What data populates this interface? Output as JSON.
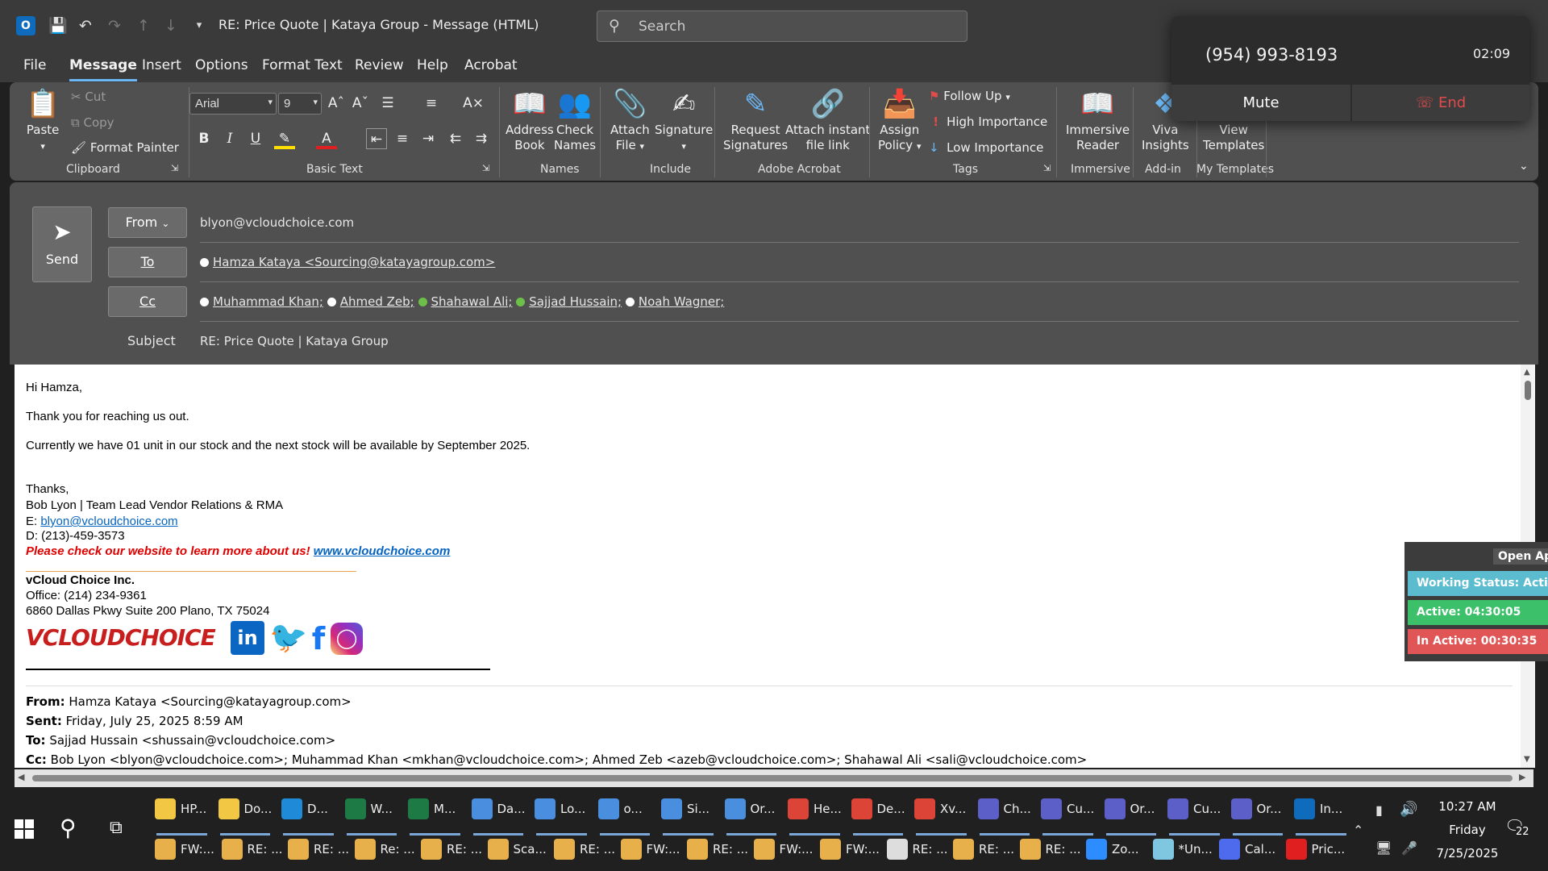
{
  "titlebar": {
    "title": "RE: Price Quote | Kataya Group  -  Message (HTML)",
    "search_placeholder": "Search"
  },
  "menu": [
    "File",
    "Message",
    "Insert",
    "Options",
    "Format Text",
    "Review",
    "Help",
    "Acrobat"
  ],
  "ribbon": {
    "clipboard": {
      "paste": "Paste",
      "cut": "Cut",
      "copy": "Copy",
      "format_painter": "Format Painter",
      "label": "Clipboard"
    },
    "basic_text": {
      "font": "Arial",
      "size": "9",
      "label": "Basic Text"
    },
    "names": {
      "address_book_1": "Address",
      "address_book_2": "Book",
      "check_names_1": "Check",
      "check_names_2": "Names",
      "label": "Names"
    },
    "include": {
      "attach_1": "Attach",
      "attach_2": "File",
      "signature": "Signature",
      "label": "Include"
    },
    "adobe": {
      "request_1": "Request",
      "request_2": "Signatures",
      "attach_link_1": "Attach instant",
      "attach_link_2": "file link",
      "label": "Adobe Acrobat"
    },
    "tags": {
      "assign_1": "Assign",
      "assign_2": "Policy",
      "follow_up": "Follow Up",
      "high": "High Importance",
      "low": "Low Importance",
      "label": "Tags"
    },
    "immersive": {
      "reader_1": "Immersive",
      "reader_2": "Reader",
      "label": "Immersive"
    },
    "addin": {
      "viva_1": "Viva",
      "viva_2": "Insights",
      "label": "Add-in"
    },
    "templates": {
      "view_1": "View",
      "view_2": "Templates",
      "label": "My Templates"
    }
  },
  "call": {
    "number": "(954) 993-8193",
    "duration": "02:09",
    "mute": "Mute",
    "end": "End"
  },
  "compose": {
    "send": "Send",
    "from_label": "From",
    "from_value": "blyon@vcloudchoice.com",
    "to_label": "To",
    "to_value": "Hamza Kataya <Sourcing@katayagroup.com>",
    "cc_label": "Cc",
    "cc": [
      {
        "name": "Muhammad Khan;",
        "status": "white"
      },
      {
        "name": "Ahmed Zeb;",
        "status": "white"
      },
      {
        "name": "Shahawal Ali;",
        "status": "green"
      },
      {
        "name": "Sajjad Hussain;",
        "status": "green"
      },
      {
        "name": "Noah Wagner;",
        "status": "white"
      }
    ],
    "subject_label": "Subject",
    "subject_value": "RE: Price Quote | Kataya Group"
  },
  "body": {
    "greeting": "Hi Hamza,",
    "line1": "Thank you for reaching us out.",
    "line2": "Currently we have 01 unit in our stock and the next stock will be available by September 2025.",
    "thanks": "Thanks,",
    "signer": "Bob Lyon | Team Lead Vendor Relations & RMA",
    "email_prefix": "E: ",
    "email": "blyon@vcloudchoice.com",
    "direct": "D: (213)-459-3573",
    "promo": "Please check our website to learn more about us!",
    "website": "www.vcloudchoice.com",
    "company": "vCloud Choice Inc.",
    "office": "Office: (214) 234-9361",
    "address": "6860 Dallas Pkwy Suite 200 Plano, TX 75024",
    "logo_text": "VCLOUDCHOICE",
    "quoted": {
      "from_label": "From:",
      "from": " Hamza Kataya <Sourcing@katayagroup.com>",
      "sent_label": "Sent:",
      "sent": " Friday, July 25, 2025 8:59 AM",
      "to_label": "To:",
      "to": " Sajjad Hussain <shussain@vcloudchoice.com>",
      "cc_label": "Cc:",
      "cc": " Bob Lyon <blyon@vcloudchoice.com>; Muhammad Khan <mkhan@vcloudchoice.com>; Ahmed Zeb <azeb@vcloudchoice.com>; Shahawal Ali <sali@vcloudchoice.com>"
    }
  },
  "monitor": {
    "open_app": "Open App",
    "status": "Working Status: Active",
    "active": "Active: 04:30:05",
    "inactive": "In Active: 00:30:35",
    "colors": {
      "status": "#5bbccf",
      "active": "#3cc06a",
      "inactive": "#e05555"
    }
  },
  "taskbar": {
    "row1": [
      {
        "label": "HP...",
        "color": "#f2c744"
      },
      {
        "label": "Do...",
        "color": "#f2c744"
      },
      {
        "label": "D...",
        "color": "#1f8ad8"
      },
      {
        "label": "W...",
        "color": "#1d7a45"
      },
      {
        "label": "M...",
        "color": "#1d7a45"
      },
      {
        "label": "Da...",
        "color": "#4a8ee0"
      },
      {
        "label": "Lo...",
        "color": "#4a8ee0"
      },
      {
        "label": "o...",
        "color": "#4a8ee0"
      },
      {
        "label": "Si...",
        "color": "#4a8ee0"
      },
      {
        "label": "Or...",
        "color": "#4a8ee0"
      },
      {
        "label": "He...",
        "color": "#db4437"
      },
      {
        "label": "De...",
        "color": "#db4437"
      },
      {
        "label": "Xv...",
        "color": "#db4437"
      },
      {
        "label": "Ch...",
        "color": "#5b5fc7"
      },
      {
        "label": "Cu...",
        "color": "#5b5fc7"
      },
      {
        "label": "Or...",
        "color": "#5b5fc7"
      },
      {
        "label": "Cu...",
        "color": "#5b5fc7"
      },
      {
        "label": "Or...",
        "color": "#5b5fc7"
      },
      {
        "label": "In...",
        "color": "#0f6cbd"
      }
    ],
    "row2": [
      {
        "label": "FW:...",
        "color": "#e8b04a"
      },
      {
        "label": "RE: ...",
        "color": "#e8b04a"
      },
      {
        "label": "RE: ...",
        "color": "#e8b04a"
      },
      {
        "label": "Re: ...",
        "color": "#e8b04a"
      },
      {
        "label": "RE: ...",
        "color": "#e8b04a"
      },
      {
        "label": "Sca...",
        "color": "#e8b04a"
      },
      {
        "label": "RE: ...",
        "color": "#e8b04a"
      },
      {
        "label": "FW:...",
        "color": "#e8b04a"
      },
      {
        "label": "RE: ...",
        "color": "#e8b04a"
      },
      {
        "label": "FW:...",
        "color": "#e8b04a"
      },
      {
        "label": "FW:...",
        "color": "#e8b04a"
      },
      {
        "label": "RE: ...",
        "color": "#dddddd"
      },
      {
        "label": "RE: ...",
        "color": "#e8b04a"
      },
      {
        "label": "RE: ...",
        "color": "#e8b04a"
      },
      {
        "label": "Zo...",
        "color": "#2d8cff"
      },
      {
        "label": "*Un...",
        "color": "#7fc6e0"
      },
      {
        "label": "Cal...",
        "color": "#4f6bed"
      },
      {
        "label": "Pric...",
        "color": "#e02020"
      }
    ],
    "time": "10:27 AM",
    "day": "Friday",
    "date": "7/25/2025",
    "notifications": "22"
  }
}
